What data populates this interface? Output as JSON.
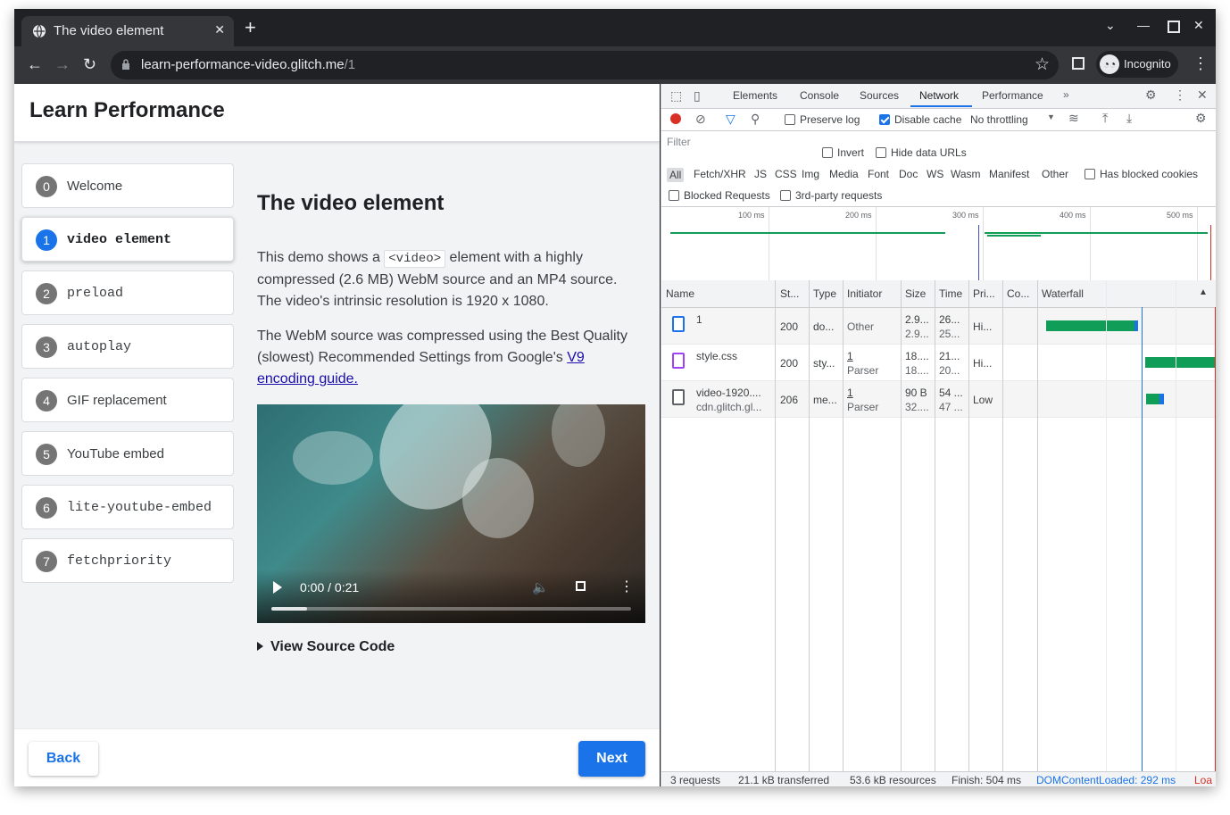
{
  "browser": {
    "tab_title": "The video element",
    "url_host": "learn-performance-video.glitch.me",
    "url_path": "/1",
    "profile_label": "Incognito"
  },
  "page": {
    "header_title": "Learn Performance",
    "nav": [
      {
        "num": "0",
        "label": "Welcome",
        "mono": false,
        "active": false
      },
      {
        "num": "1",
        "label": "video element",
        "mono": true,
        "active": true
      },
      {
        "num": "2",
        "label": "preload",
        "mono": true,
        "active": false
      },
      {
        "num": "3",
        "label": "autoplay",
        "mono": true,
        "active": false
      },
      {
        "num": "4",
        "label": "GIF replacement",
        "mono": false,
        "active": false
      },
      {
        "num": "5",
        "label": "YouTube embed",
        "mono": false,
        "active": false
      },
      {
        "num": "6",
        "label": "lite-youtube-embed",
        "mono": true,
        "active": false
      },
      {
        "num": "7",
        "label": "fetchpriority",
        "mono": true,
        "active": false
      }
    ],
    "heading": "The video element",
    "para1_a": "This demo shows a ",
    "para1_code": "<video>",
    "para1_b": " element with a highly compressed (2.6 MB) WebM source and an MP4 source. The video's intrinsic resolution is 1920 x 1080.",
    "para2_a": "The WebM source was compressed using the Best Quality (slowest) Recommended Settings from Google's ",
    "para2_link": "V9 encoding guide.",
    "video_time": "0:00 / 0:21",
    "video_progress": 0.1,
    "view_source": "View Source Code",
    "back": "Back",
    "next": "Next"
  },
  "devtools": {
    "tabs": [
      "Elements",
      "Console",
      "Sources",
      "Network",
      "Performance"
    ],
    "active_tab": "Network",
    "preserve_log": "Preserve log",
    "disable_cache": "Disable cache",
    "throttling": "No throttling",
    "filter_placeholder": "Filter",
    "invert": "Invert",
    "hide_data_urls": "Hide data URLs",
    "types": [
      "All",
      "Fetch/XHR",
      "JS",
      "CSS",
      "Img",
      "Media",
      "Font",
      "Doc",
      "WS",
      "Wasm",
      "Manifest",
      "Other"
    ],
    "has_blocked_cookies": "Has blocked cookies",
    "blocked_requests": "Blocked Requests",
    "third_party": "3rd-party requests",
    "overview_ticks": [
      "100 ms",
      "200 ms",
      "300 ms",
      "400 ms",
      "500 ms"
    ],
    "columns": [
      "Name",
      "St...",
      "Type",
      "Initiator",
      "Size",
      "Time",
      "Pri...",
      "Co...",
      "Waterfall"
    ],
    "rows": [
      {
        "name": "1",
        "name2": "",
        "status": "200",
        "type": "do...",
        "initiator": "Other",
        "initiator2": "",
        "size": "2.9...",
        "size2": "2.9...",
        "time": "26...",
        "time2": "25...",
        "priority": "Hi..."
      },
      {
        "name": "style.css",
        "name2": "",
        "status": "200",
        "type": "sty...",
        "initiator": "1",
        "initiator2": "Parser",
        "size": "18....",
        "size2": "18....",
        "time": "21...",
        "time2": "20...",
        "priority": "Hi..."
      },
      {
        "name": "video-1920....",
        "name2": "cdn.glitch.gl...",
        "status": "206",
        "type": "me...",
        "initiator": "1",
        "initiator2": "Parser",
        "size": "90 B",
        "size2": "32....",
        "time": "54 ...",
        "time2": "47 ...",
        "priority": "Low"
      }
    ],
    "status": {
      "requests": "3 requests",
      "transferred": "21.1 kB transferred",
      "resources": "53.6 kB resources",
      "finish": "Finish: 504 ms",
      "dcl": "DOMContentLoaded: 292 ms",
      "load": "Loa"
    },
    "colors": {
      "accent": "#1a73e8",
      "waterfall_green": "#0f9d58",
      "record_red": "#d93025"
    }
  }
}
